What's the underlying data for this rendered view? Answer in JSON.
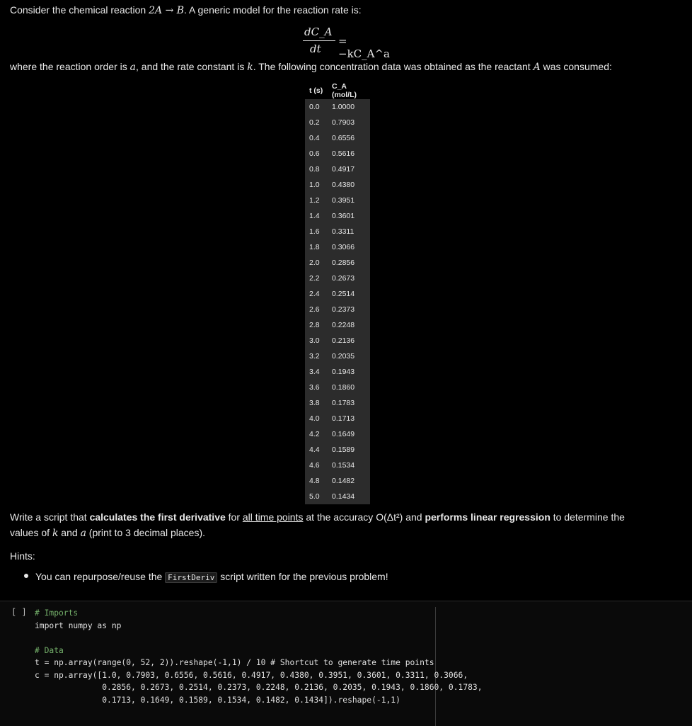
{
  "problem": {
    "intro_text": "Consider the chemical reaction ",
    "reaction": "2A → B",
    "intro_tail": ". A generic model for the reaction rate is:",
    "equation_numerator": "dC_A",
    "equation_denominator": "dt",
    "equation_rhs": "= −kC_A^a",
    "desc_part1": "where the reaction order is ",
    "desc_var_a": "a",
    "desc_part2": ", and the rate constant is ",
    "desc_var_k": "k",
    "desc_part3": ". The following concentration data was obtained as the reactant ",
    "desc_var_A": "A",
    "desc_part4": " was consumed:",
    "table": {
      "headers": [
        "t (s)",
        "C_A (mol/L)"
      ],
      "rows": [
        [
          "0.0",
          "1.0000"
        ],
        [
          "0.2",
          "0.7903"
        ],
        [
          "0.4",
          "0.6556"
        ],
        [
          "0.6",
          "0.5616"
        ],
        [
          "0.8",
          "0.4917"
        ],
        [
          "1.0",
          "0.4380"
        ],
        [
          "1.2",
          "0.3951"
        ],
        [
          "1.4",
          "0.3601"
        ],
        [
          "1.6",
          "0.3311"
        ],
        [
          "1.8",
          "0.3066"
        ],
        [
          "2.0",
          "0.2856"
        ],
        [
          "2.2",
          "0.2673"
        ],
        [
          "2.4",
          "0.2514"
        ],
        [
          "2.6",
          "0.2373"
        ],
        [
          "2.8",
          "0.2248"
        ],
        [
          "3.0",
          "0.2136"
        ],
        [
          "3.2",
          "0.2035"
        ],
        [
          "3.4",
          "0.1943"
        ],
        [
          "3.6",
          "0.1860"
        ],
        [
          "3.8",
          "0.1783"
        ],
        [
          "4.0",
          "0.1713"
        ],
        [
          "4.2",
          "0.1649"
        ],
        [
          "4.4",
          "0.1589"
        ],
        [
          "4.6",
          "0.1534"
        ],
        [
          "4.8",
          "0.1482"
        ],
        [
          "5.0",
          "0.1434"
        ]
      ]
    },
    "task_1": "Write a script that ",
    "task_bold_1": "calculates the first derivative",
    "task_2": " for ",
    "task_underline": "all time points",
    "task_3": " at the accuracy O(Δt²) and ",
    "task_bold_2": "performs linear regression",
    "task_4": " to determine the",
    "task_5a": "values of ",
    "task_5k": "k",
    "task_5b": " and ",
    "task_5a2": "a",
    "task_5c": " (print to 3 decimal places).",
    "hints_label": "Hints:",
    "hint_1a": "You can repurpose/reuse the ",
    "hint_1code": "FirstDeriv",
    "hint_1b": " script written for the previous problem!"
  },
  "code_cell": {
    "run_indicator": "[ ]",
    "lines": [
      "# Imports",
      "import numpy as np",
      "",
      "# Data",
      "t = np.array(range(0, 52, 2)).reshape(-1,1) / 10 # Shortcut to generate time points",
      "c = np.array([1.0, 0.7903, 0.6556, 0.5616, 0.4917, 0.4380, 0.3951, 0.3601, 0.3311, 0.3066,",
      "              0.2856, 0.2673, 0.2514, 0.2373, 0.2248, 0.2136, 0.2035, 0.1943, 0.1860, 0.1783,",
      "              0.1713, 0.1649, 0.1589, 0.1534, 0.1482, 0.1434]).reshape(-1,1)"
    ]
  }
}
